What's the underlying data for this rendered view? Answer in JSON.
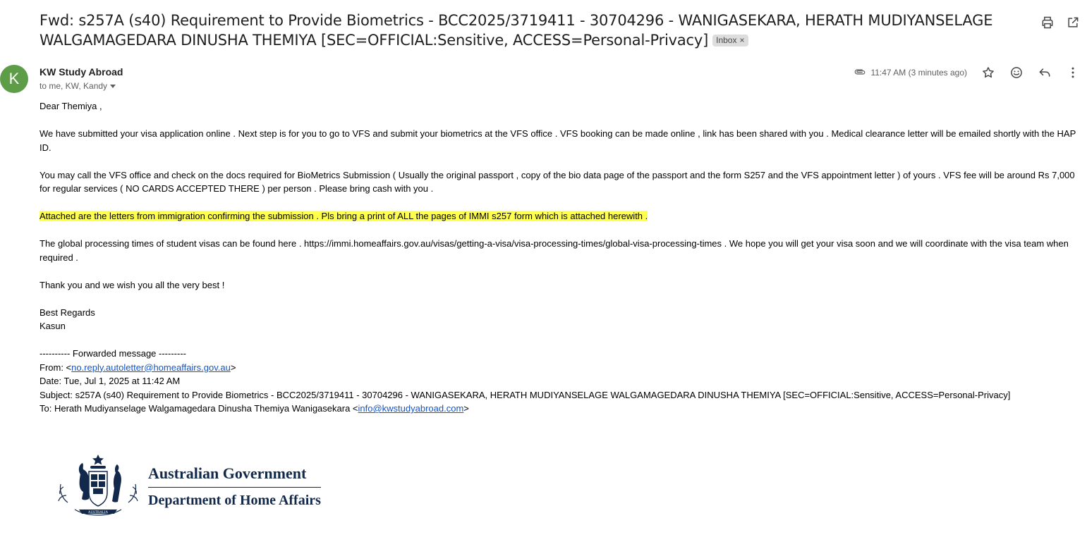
{
  "email": {
    "subject": "Fwd: s257A (s40) Requirement to Provide Biometrics - BCC2025/3719411 - 30704296 - WANIGASEKARA, HERATH MUDIYANSELAGE WALGAMAGEDARA DINUSHA THEMIYA [SEC=OFFICIAL:Sensitive, ACCESS=Personal-Privacy]",
    "label_chip": "Inbox",
    "sender_initial": "K",
    "sender_name": "KW Study Abroad",
    "recipients": "to me, KW, Kandy",
    "time": "11:47 AM (3 minutes ago)",
    "avatar_color": "#5d9d47"
  },
  "body": {
    "greeting": "Dear Themiya ,",
    "p1": "We have submitted your visa application online . Next step is  for you to go to VFS and submit your biometrics at the VFS office . VFS booking can be made online , link has been shared with you . Medical clearance letter will be emailed shortly with the HAP ID.",
    "p2": "You may call the VFS office  and check on the docs required for BioMetrics Submission ( Usually the original passport , copy of the bio data page of the passport and the form S257 and the VFS appointment letter ) of yours . VFS fee will be around Rs 7,000 for regular services  ( NO CARDS ACCEPTED THERE ) per person . Please bring cash with you .",
    "p3_highlight": "Attached are the letters from immigration confirming the submission . Pls bring a print of ALL the pages of IMMI s257 form which is attached herewith .",
    "p4": "The global processing times of student visas can be found here . https://immi.homeaffairs.gov.au/visas/getting-a-visa/visa-processing-times/global-visa-processing-times . We hope you will get your visa soon  and we will coordinate with the visa team when required .",
    "p5": "Thank you and we wish you all the very best !",
    "signoff": "Best Regards",
    "signature": "Kasun",
    "highlight_color": "#ffff4d"
  },
  "forwarded": {
    "header": "---------- Forwarded message ---------",
    "from_label": "From: <",
    "from_email": "no.reply.autoletter@homeaffairs.gov.au",
    "from_end": ">",
    "date": "Date: Tue, Jul 1, 2025 at 11:42 AM",
    "subject": "Subject: s257A (s40) Requirement to Provide Biometrics - BCC2025/3719411 - 30704296 - WANIGASEKARA, HERATH MUDIYANSELAGE WALGAMAGEDARA DINUSHA THEMIYA [SEC=OFFICIAL:Sensitive, ACCESS=Personal-Privacy]",
    "to_label": "To: Herath Mudiyanselage Walgamagedara Dinusha Themiya Wanigasekara <",
    "to_email": "info@kwstudyabroad.com",
    "to_end": ">"
  },
  "logo": {
    "line1": "Australian Government",
    "line2": "Department of Home Affairs",
    "crest_ribbon": "AUSTRALIA"
  },
  "icons": {
    "print": "printer-icon",
    "popout": "open-in-new-window-icon",
    "attachment": "paperclip-icon",
    "star": "star-icon",
    "emoji": "emoji-reaction-icon",
    "reply": "reply-icon",
    "more": "more-vertical-icon"
  }
}
